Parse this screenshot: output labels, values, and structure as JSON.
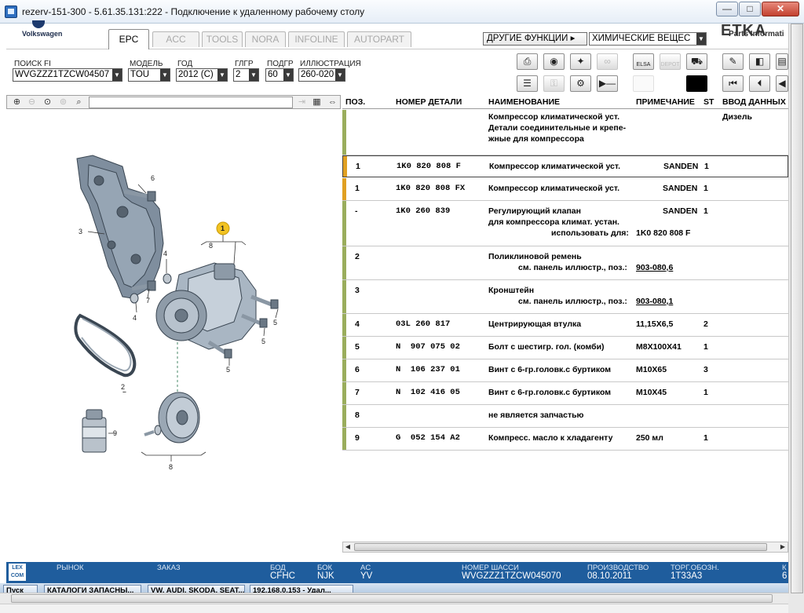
{
  "window": {
    "title": "rezerv-151-300 - 5.61.35.131:222 - Подключение к удаленному рабочему столу",
    "minimize": "—",
    "maximize": "□",
    "close": "✕"
  },
  "header": {
    "brand_label": "Volkswagen",
    "etka_text": "ETKA",
    "parts_info": "Parts Informati",
    "tabs": [
      "EPC",
      "ACC",
      "TOOLS",
      "NORA",
      "INFOLINE",
      "AUTOPART"
    ],
    "active_tab": "EPC",
    "other_functions": "ДРУГИЕ ФУНКЦИИ ▸",
    "chem_dropdown": "ХИМИЧЕСКИЕ ВЕЩЕС"
  },
  "filters": {
    "search_fi": {
      "label": "ПОИСК FI",
      "value": "WVGZZZ1TZCW04507"
    },
    "model": {
      "label": "МОДЕЛЬ",
      "value": "TOU"
    },
    "year": {
      "label": "ГОД",
      "value": "2012 (C)"
    },
    "main_group": {
      "label": "ГЛГР",
      "value": "2"
    },
    "sub_group": {
      "label": "ПОДГР",
      "value": "60"
    },
    "illustration": {
      "label": "ИЛЛЮСТРАЦИЯ",
      "value": "260-020"
    }
  },
  "toolbar": {
    "row1": [
      "print-icon",
      "map-icon",
      "bookmark-icon",
      "service-icon",
      "elsa-icon",
      "depot-icon",
      "cart-icon",
      "pin-icon",
      "back-page-icon",
      "next-page-icon"
    ],
    "row2": [
      "list-icon",
      "key-icon",
      "bike-icon",
      "play-line-icon",
      "blank-icon",
      "black-box-icon",
      "first-icon",
      "prev-icon",
      "prev2-icon"
    ],
    "elsa_label": "ELSA",
    "depot_label": "DEPOT"
  },
  "illustration": {
    "callouts": [
      "6",
      "3",
      "4",
      "7",
      "4",
      "1",
      "8",
      "5",
      "5",
      "5",
      "2",
      "9",
      "8"
    ],
    "highlight_color": "#f2c322"
  },
  "table": {
    "headers": [
      "ПОЗ.",
      "НОМЕР ДЕТАЛИ",
      "НАИМЕНОВАНИЕ",
      "ПРИМЕЧАНИЕ",
      "ST",
      "ВВОД ДАННЫХ"
    ],
    "group_header": {
      "lines": [
        "Компрессор климатической уст.",
        "Детали соединительные и крепе-",
        "жные для компрессора"
      ],
      "input": "Дизель"
    },
    "rows": [
      {
        "pos": "1",
        "part": "1K0 820 808 F",
        "name": [
          "Компрессор климатической уст."
        ],
        "note": "SANDEN",
        "st": "1"
      },
      {
        "pos": "1",
        "part": "1K0 820 808 FX",
        "name": [
          "Компрессор климатической уст."
        ],
        "note": "SANDEN",
        "st": "1"
      },
      {
        "pos": "-",
        "part": "1K0 260 839",
        "name": [
          "Регулирующий клапан",
          "для компрессора климат. устан.",
          "использовать для:"
        ],
        "note": "SANDEN",
        "note2": "1K0 820 808 F",
        "st": "1"
      },
      {
        "pos": "2",
        "part": "",
        "name": [
          "Поликлиновой ремень",
          "см. панель иллюстр., поз.:"
        ],
        "note": "",
        "note2": "903-080,6",
        "st": ""
      },
      {
        "pos": "3",
        "part": "",
        "name": [
          "Кронштейн",
          "см. панель иллюстр., поз.:"
        ],
        "note": "",
        "note2": "903-080,1",
        "st": ""
      },
      {
        "pos": "4",
        "part": "03L 260 817",
        "name": [
          "Центрирующая втулка"
        ],
        "note": "11,15X6,5",
        "st": "2"
      },
      {
        "pos": "5",
        "part": "N  907 075 02",
        "name": [
          "Болт с шестигр. гол. (комби)"
        ],
        "note": "M8X100X41",
        "st": "1"
      },
      {
        "pos": "6",
        "part": "N  106 237 01",
        "name": [
          "Винт с 6-гр.головк.с буртиком"
        ],
        "note": "M10X65",
        "st": "3"
      },
      {
        "pos": "7",
        "part": "N  102 416 05",
        "name": [
          "Винт с 6-гр.головк.с буртиком"
        ],
        "note": "M10X45",
        "st": "1"
      },
      {
        "pos": "8",
        "part": "",
        "name": [
          "не является запчастью"
        ],
        "note": "",
        "st": ""
      },
      {
        "pos": "9",
        "part": "G  052 154 A2",
        "name": [
          "Компресс. масло к хладагенту"
        ],
        "note": "250 мл",
        "st": "1"
      }
    ],
    "colors": {
      "green": "#9aad5c",
      "orange": "#e0a022"
    }
  },
  "status": {
    "logo": "LEX COM",
    "market_label": "РЫНОК",
    "order_label": "ЗАКАЗ",
    "bod_label": "БОД",
    "bod_value": "CFHC",
    "box_label": "БОК",
    "box_value": "NJK",
    "ac_label": "AC",
    "ac_value": "YV",
    "vin_label": "НОМЕР ШАССИ",
    "vin_value": "WVGZZZ1TZCW045070",
    "prod_label": "ПРОИЗВОДСТВО",
    "prod_value": "08.10.2011",
    "torg_label": "ТОРГ.ОБОЗН.",
    "torg_value": "1T33A3",
    "k_label": "К",
    "k_value": "6",
    "accent_color": "#1f5d9d"
  },
  "taskbar": {
    "start": "Пуск",
    "items": [
      "КАТАЛОГИ ЗАПАСНЫ...",
      "VW, AUDI, SKODA, SEAT...",
      "192.168.0.153 - Удал..."
    ]
  }
}
